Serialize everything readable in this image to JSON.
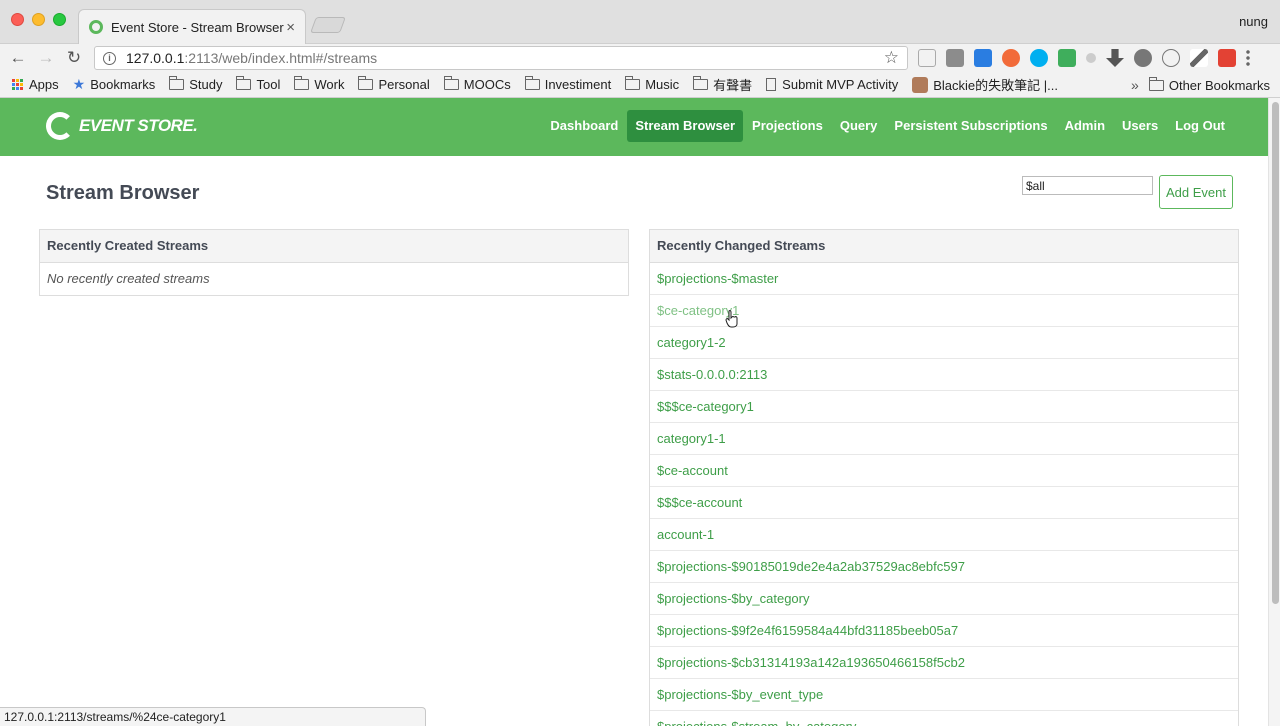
{
  "browser": {
    "tab_title": "Event Store - Stream Browser",
    "tab_close": "×",
    "profile_name": "nung",
    "url_host": "127.0.0.1",
    "url_rest": ":2113/web/index.html#/streams",
    "info_glyph": "i",
    "back_glyph": "←",
    "forward_glyph": "→",
    "reload_glyph": "↻",
    "star_glyph": "☆",
    "bookmarks": [
      {
        "label": "Apps",
        "icon": "apps-icon"
      },
      {
        "label": "Bookmarks",
        "icon": "star-icon"
      },
      {
        "label": "Study",
        "icon": "folder-icon"
      },
      {
        "label": "Tool",
        "icon": "folder-icon"
      },
      {
        "label": "Work",
        "icon": "folder-icon"
      },
      {
        "label": "Personal",
        "icon": "folder-icon"
      },
      {
        "label": "MOOCs",
        "icon": "folder-icon"
      },
      {
        "label": "Investiment",
        "icon": "folder-icon"
      },
      {
        "label": "Music",
        "icon": "folder-icon"
      },
      {
        "label": "有聲書",
        "icon": "folder-icon"
      },
      {
        "label": "Submit MVP Activity",
        "icon": "page-icon"
      },
      {
        "label": "Blackie的失敗筆記 |...",
        "icon": "avatar-icon"
      }
    ],
    "more_bookmarks_glyph": "»",
    "other_bookmarks": "Other Bookmarks",
    "status_url": "127.0.0.1:2113/streams/%24ce-category1"
  },
  "app": {
    "logo_text": "EVENT STORE.",
    "nav": [
      {
        "label": "Dashboard",
        "active": false
      },
      {
        "label": "Stream Browser",
        "active": true
      },
      {
        "label": "Projections",
        "active": false
      },
      {
        "label": "Query",
        "active": false
      },
      {
        "label": "Persistent Subscriptions",
        "active": false
      },
      {
        "label": "Admin",
        "active": false
      },
      {
        "label": "Users",
        "active": false
      },
      {
        "label": "Log Out",
        "active": false
      }
    ],
    "page_title": "Stream Browser",
    "stream_input_value": "$all",
    "add_event_label": "Add Event",
    "recently_created": {
      "title": "Recently Created Streams",
      "empty_text": "No recently created streams"
    },
    "recently_changed": {
      "title": "Recently Changed Streams",
      "hovered_index": 1,
      "streams": [
        "$projections-$master",
        "$ce-category1",
        "category1-2",
        "$stats-0.0.0.0:2113",
        "$$$ce-category1",
        "category1-1",
        "$ce-account",
        "$$$ce-account",
        "account-1",
        "$projections-$90185019de2e4a2ab37529ac8ebfc597",
        "$projections-$by_category",
        "$projections-$9f2e4f6159584a44bfd31185beeb05a7",
        "$projections-$cb31314193a142a193650466158f5cb2",
        "$projections-$by_event_type",
        "$projections-$stream_by_category"
      ]
    }
  },
  "colors": {
    "brand_green": "#5cb85c",
    "active_nav": "#2e8f3f",
    "link_green": "#3e9e48"
  }
}
